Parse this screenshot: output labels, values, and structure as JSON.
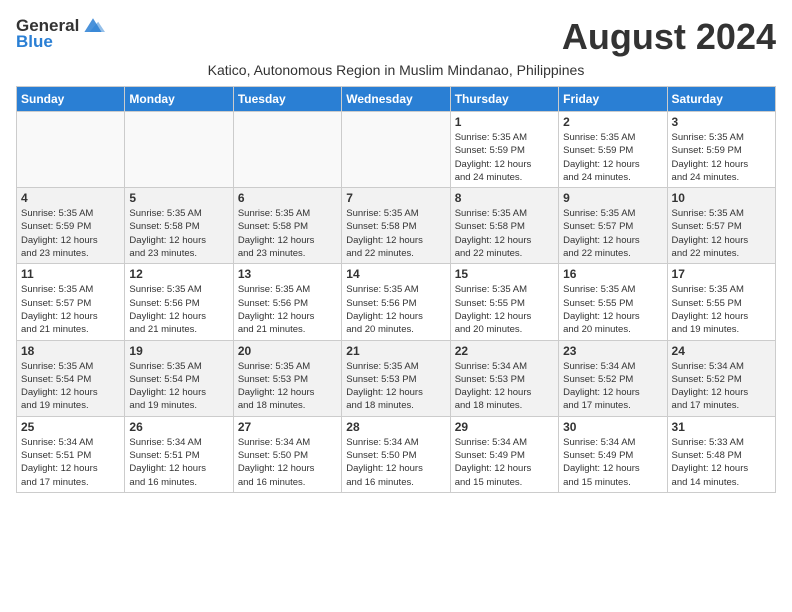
{
  "logo": {
    "general": "General",
    "blue": "Blue"
  },
  "title": "August 2024",
  "subtitle": "Katico, Autonomous Region in Muslim Mindanao, Philippines",
  "headers": [
    "Sunday",
    "Monday",
    "Tuesday",
    "Wednesday",
    "Thursday",
    "Friday",
    "Saturday"
  ],
  "weeks": [
    [
      {
        "day": "",
        "info": ""
      },
      {
        "day": "",
        "info": ""
      },
      {
        "day": "",
        "info": ""
      },
      {
        "day": "",
        "info": ""
      },
      {
        "day": "1",
        "info": "Sunrise: 5:35 AM\nSunset: 5:59 PM\nDaylight: 12 hours\nand 24 minutes."
      },
      {
        "day": "2",
        "info": "Sunrise: 5:35 AM\nSunset: 5:59 PM\nDaylight: 12 hours\nand 24 minutes."
      },
      {
        "day": "3",
        "info": "Sunrise: 5:35 AM\nSunset: 5:59 PM\nDaylight: 12 hours\nand 24 minutes."
      }
    ],
    [
      {
        "day": "4",
        "info": "Sunrise: 5:35 AM\nSunset: 5:59 PM\nDaylight: 12 hours\nand 23 minutes."
      },
      {
        "day": "5",
        "info": "Sunrise: 5:35 AM\nSunset: 5:58 PM\nDaylight: 12 hours\nand 23 minutes."
      },
      {
        "day": "6",
        "info": "Sunrise: 5:35 AM\nSunset: 5:58 PM\nDaylight: 12 hours\nand 23 minutes."
      },
      {
        "day": "7",
        "info": "Sunrise: 5:35 AM\nSunset: 5:58 PM\nDaylight: 12 hours\nand 22 minutes."
      },
      {
        "day": "8",
        "info": "Sunrise: 5:35 AM\nSunset: 5:58 PM\nDaylight: 12 hours\nand 22 minutes."
      },
      {
        "day": "9",
        "info": "Sunrise: 5:35 AM\nSunset: 5:57 PM\nDaylight: 12 hours\nand 22 minutes."
      },
      {
        "day": "10",
        "info": "Sunrise: 5:35 AM\nSunset: 5:57 PM\nDaylight: 12 hours\nand 22 minutes."
      }
    ],
    [
      {
        "day": "11",
        "info": "Sunrise: 5:35 AM\nSunset: 5:57 PM\nDaylight: 12 hours\nand 21 minutes."
      },
      {
        "day": "12",
        "info": "Sunrise: 5:35 AM\nSunset: 5:56 PM\nDaylight: 12 hours\nand 21 minutes."
      },
      {
        "day": "13",
        "info": "Sunrise: 5:35 AM\nSunset: 5:56 PM\nDaylight: 12 hours\nand 21 minutes."
      },
      {
        "day": "14",
        "info": "Sunrise: 5:35 AM\nSunset: 5:56 PM\nDaylight: 12 hours\nand 20 minutes."
      },
      {
        "day": "15",
        "info": "Sunrise: 5:35 AM\nSunset: 5:55 PM\nDaylight: 12 hours\nand 20 minutes."
      },
      {
        "day": "16",
        "info": "Sunrise: 5:35 AM\nSunset: 5:55 PM\nDaylight: 12 hours\nand 20 minutes."
      },
      {
        "day": "17",
        "info": "Sunrise: 5:35 AM\nSunset: 5:55 PM\nDaylight: 12 hours\nand 19 minutes."
      }
    ],
    [
      {
        "day": "18",
        "info": "Sunrise: 5:35 AM\nSunset: 5:54 PM\nDaylight: 12 hours\nand 19 minutes."
      },
      {
        "day": "19",
        "info": "Sunrise: 5:35 AM\nSunset: 5:54 PM\nDaylight: 12 hours\nand 19 minutes."
      },
      {
        "day": "20",
        "info": "Sunrise: 5:35 AM\nSunset: 5:53 PM\nDaylight: 12 hours\nand 18 minutes."
      },
      {
        "day": "21",
        "info": "Sunrise: 5:35 AM\nSunset: 5:53 PM\nDaylight: 12 hours\nand 18 minutes."
      },
      {
        "day": "22",
        "info": "Sunrise: 5:34 AM\nSunset: 5:53 PM\nDaylight: 12 hours\nand 18 minutes."
      },
      {
        "day": "23",
        "info": "Sunrise: 5:34 AM\nSunset: 5:52 PM\nDaylight: 12 hours\nand 17 minutes."
      },
      {
        "day": "24",
        "info": "Sunrise: 5:34 AM\nSunset: 5:52 PM\nDaylight: 12 hours\nand 17 minutes."
      }
    ],
    [
      {
        "day": "25",
        "info": "Sunrise: 5:34 AM\nSunset: 5:51 PM\nDaylight: 12 hours\nand 17 minutes."
      },
      {
        "day": "26",
        "info": "Sunrise: 5:34 AM\nSunset: 5:51 PM\nDaylight: 12 hours\nand 16 minutes."
      },
      {
        "day": "27",
        "info": "Sunrise: 5:34 AM\nSunset: 5:50 PM\nDaylight: 12 hours\nand 16 minutes."
      },
      {
        "day": "28",
        "info": "Sunrise: 5:34 AM\nSunset: 5:50 PM\nDaylight: 12 hours\nand 16 minutes."
      },
      {
        "day": "29",
        "info": "Sunrise: 5:34 AM\nSunset: 5:49 PM\nDaylight: 12 hours\nand 15 minutes."
      },
      {
        "day": "30",
        "info": "Sunrise: 5:34 AM\nSunset: 5:49 PM\nDaylight: 12 hours\nand 15 minutes."
      },
      {
        "day": "31",
        "info": "Sunrise: 5:33 AM\nSunset: 5:48 PM\nDaylight: 12 hours\nand 14 minutes."
      }
    ]
  ]
}
